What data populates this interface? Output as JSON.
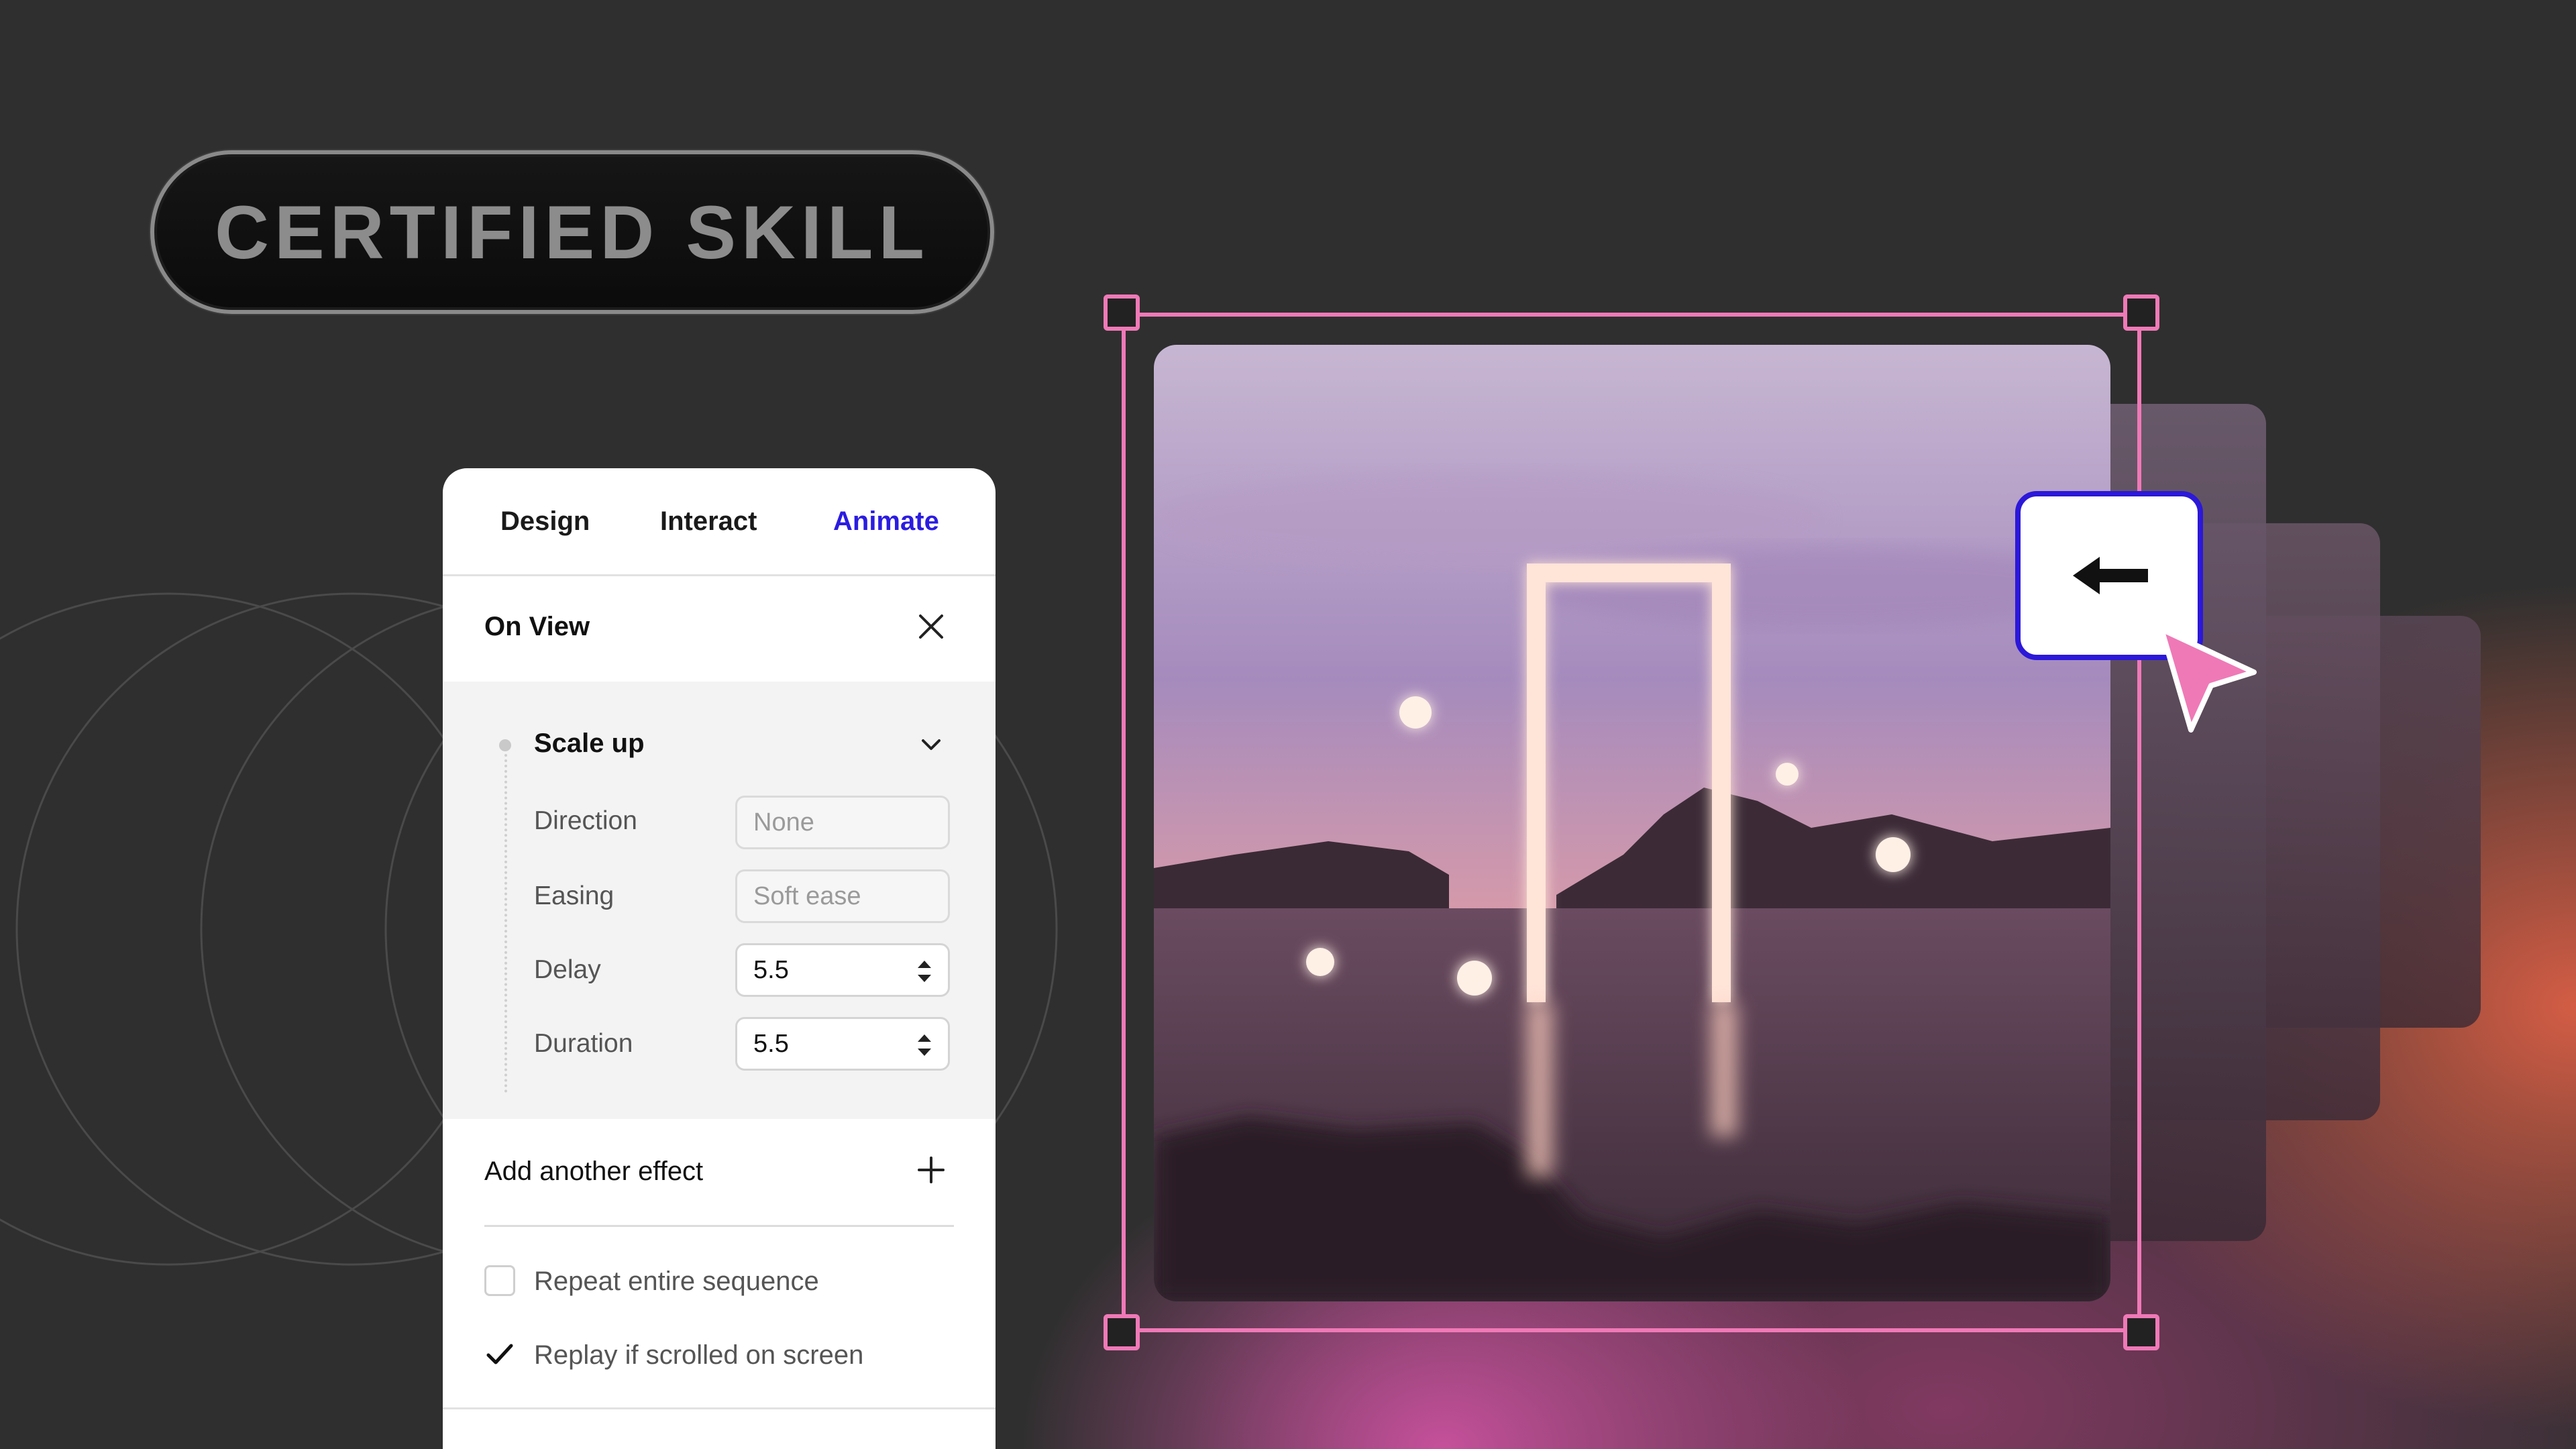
{
  "badge": {
    "text": "CERTIFIED SKILL"
  },
  "panel": {
    "tabs": [
      {
        "label": "Design",
        "active": false
      },
      {
        "label": "Interact",
        "active": false
      },
      {
        "label": "Animate",
        "active": true
      }
    ],
    "trigger": {
      "title": "On View"
    },
    "effect": {
      "title": "Scale up",
      "rows": [
        {
          "label": "Direction",
          "value": "None",
          "type": "select"
        },
        {
          "label": "Easing",
          "value": "Soft ease",
          "type": "select"
        },
        {
          "label": "Delay",
          "value": "5.5",
          "type": "number"
        },
        {
          "label": "Duration",
          "value": "5.5",
          "type": "number"
        }
      ]
    },
    "add_effect": {
      "label": "Add another effect"
    },
    "options": [
      {
        "label": "Repeat entire sequence",
        "checked": false
      },
      {
        "label": "Replay if scrolled on screen",
        "checked": true
      }
    ]
  },
  "canvas": {
    "selection_color": "#ef79b7",
    "arrow_button_icon": "arrow-left-icon",
    "accent_color": "#2c18d8"
  }
}
